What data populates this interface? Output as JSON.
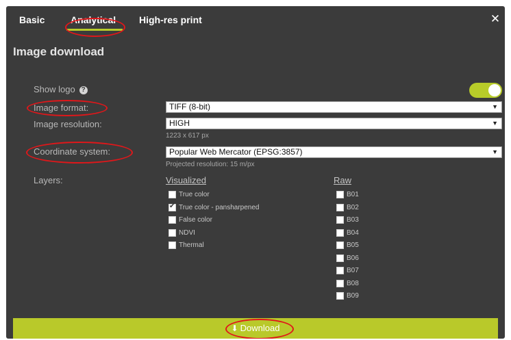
{
  "tabs": [
    {
      "label": "Basic",
      "active": false
    },
    {
      "label": "Analytical",
      "active": true
    },
    {
      "label": "High-res print",
      "active": false
    }
  ],
  "close_icon": "close-icon",
  "title": "Image download",
  "show_logo": {
    "label": "Show logo",
    "help_glyph": "?",
    "enabled": true
  },
  "image_format": {
    "label": "Image format:",
    "value": "TIFF (8-bit)"
  },
  "image_resolution": {
    "label": "Image resolution:",
    "value": "HIGH",
    "hint": "1223 x 617 px"
  },
  "coordinate_system": {
    "label": "Coordinate system:",
    "value": "Popular Web Mercator (EPSG:3857)",
    "hint": "Projected resolution: 15 m/px"
  },
  "layers": {
    "label": "Layers:",
    "visualized": {
      "header": "Visualized",
      "items": [
        {
          "label": "True color",
          "checked": false
        },
        {
          "label": "True color - pansharpened",
          "checked": true
        },
        {
          "label": "False color",
          "checked": false
        },
        {
          "label": "NDVI",
          "checked": false
        },
        {
          "label": "Thermal",
          "checked": false
        }
      ]
    },
    "raw": {
      "header": "Raw",
      "items": [
        {
          "label": "B01",
          "checked": false
        },
        {
          "label": "B02",
          "checked": false
        },
        {
          "label": "B03",
          "checked": false
        },
        {
          "label": "B04",
          "checked": false
        },
        {
          "label": "B05",
          "checked": false
        },
        {
          "label": "B06",
          "checked": false
        },
        {
          "label": "B07",
          "checked": false
        },
        {
          "label": "B08",
          "checked": false
        },
        {
          "label": "B09",
          "checked": false
        }
      ]
    }
  },
  "download": {
    "label": "Download",
    "icon": "download-icon"
  },
  "colors": {
    "accent": "#b8cc29",
    "panel": "#3b3b3b",
    "annotation": "#e0171a"
  }
}
